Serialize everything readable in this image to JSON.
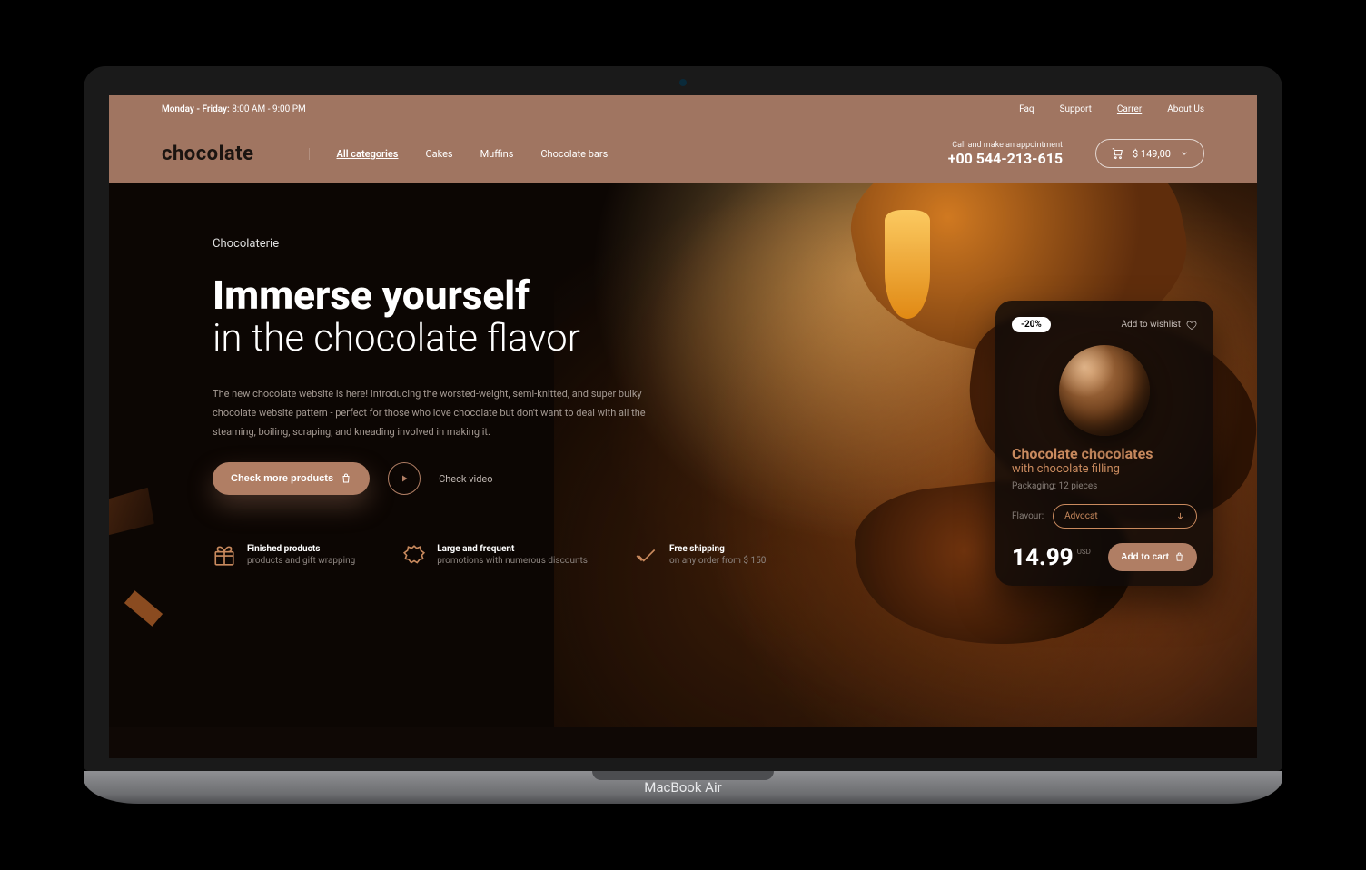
{
  "topbar": {
    "hours_label": "Monday - Friday:",
    "hours_value": "8:00 AM - 9:00 PM",
    "links": [
      "Faq",
      "Support",
      "Carrer",
      "About Us"
    ],
    "underlined_index": 2
  },
  "header": {
    "brand": "chocolate",
    "nav": [
      "All categories",
      "Cakes",
      "Muffins",
      "Chocolate bars"
    ],
    "nav_active_index": 0,
    "phone_label": "Call and make an appointment",
    "phone": "+00 544-213-615",
    "cart_total": "$ 149,00"
  },
  "hero": {
    "eyebrow": "Chocolaterie",
    "headline_bold": "Immerse yourself",
    "headline_light": "in the chocolate flavor",
    "lead": "The new chocolate website is here! Introducing the worsted-weight, semi-knitted, and super bulky chocolate website pattern - perfect for those who love chocolate but don't want to deal with all the steaming, boiling, scraping, and kneading involved in making it.",
    "cta_primary": "Check more products",
    "cta_video": "Check video"
  },
  "features": [
    {
      "title": "Finished products",
      "sub": "products and gift wrapping"
    },
    {
      "title": "Large and frequent",
      "sub": "promotions with numerous discounts"
    },
    {
      "title": "Free shipping",
      "sub": "on any order from $ 150"
    }
  ],
  "product": {
    "discount": "-20%",
    "wishlist_label": "Add to wishlist",
    "title": "Chocolate chocolates",
    "subtitle": "with chocolate filling",
    "packaging_label": "Packaging:",
    "packaging_value": "12 pieces",
    "flavour_label": "Flavour:",
    "flavour_value": "Advocat",
    "price": "14.99",
    "currency": "USD",
    "add_label": "Add to cart"
  },
  "device": {
    "model": "MacBook Air"
  }
}
